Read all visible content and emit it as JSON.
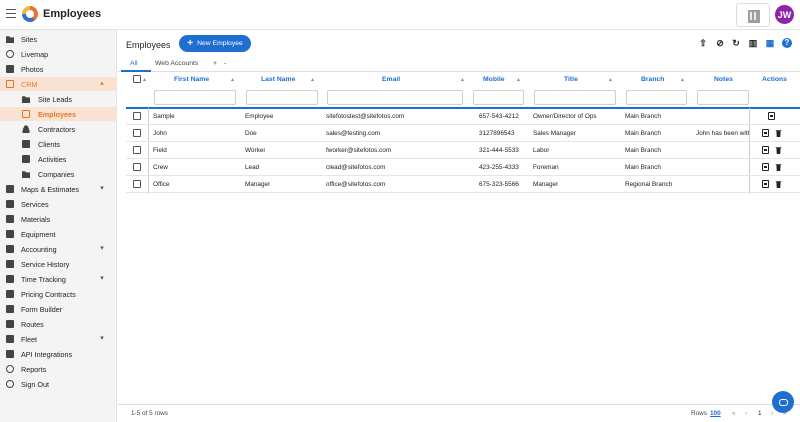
{
  "app": {
    "title": "Employees",
    "avatar_initials": "JW",
    "avatar_color": "#8e24aa",
    "accent": "#1f6fd0",
    "crm_accent": "#e8752b"
  },
  "sidebar": {
    "items": [
      {
        "label": "Sites",
        "icon": "folder-icon"
      },
      {
        "label": "Livemap",
        "icon": "globe-icon"
      },
      {
        "label": "Photos",
        "icon": "image-icon"
      },
      {
        "label": "CRM",
        "icon": "crm-icon",
        "expanded": true
      },
      {
        "label": "Site Leads",
        "icon": "folder-icon",
        "sub": true
      },
      {
        "label": "Employees",
        "icon": "employees-icon",
        "sub": true,
        "active": true
      },
      {
        "label": "Contractors",
        "icon": "person-icon",
        "sub": true
      },
      {
        "label": "Clients",
        "icon": "phone-icon",
        "sub": true
      },
      {
        "label": "Activities",
        "icon": "calendar-icon",
        "sub": true
      },
      {
        "label": "Companies",
        "icon": "folder-icon",
        "sub": true
      },
      {
        "label": "Maps & Estimates",
        "icon": "map-icon"
      },
      {
        "label": "Services",
        "icon": "wrench-icon"
      },
      {
        "label": "Materials",
        "icon": "list-icon"
      },
      {
        "label": "Equipment",
        "icon": "equipment-icon"
      },
      {
        "label": "Accounting",
        "icon": "accounting-icon"
      },
      {
        "label": "Service History",
        "icon": "history-icon"
      },
      {
        "label": "Time Tracking",
        "icon": "clock-icon"
      },
      {
        "label": "Pricing Contracts",
        "icon": "dollar-icon"
      },
      {
        "label": "Form Builder",
        "icon": "form-icon"
      },
      {
        "label": "Routes",
        "icon": "route-icon"
      },
      {
        "label": "Fleet",
        "icon": "truck-icon"
      },
      {
        "label": "API Integrations",
        "icon": "link-icon"
      },
      {
        "label": "Reports",
        "icon": "info-icon"
      },
      {
        "label": "Sign Out",
        "icon": "power-icon"
      }
    ]
  },
  "main": {
    "title": "Employees",
    "new_button": "New Employee",
    "tabs": [
      "All",
      "Web Accounts"
    ],
    "tab_add": "+",
    "tab_remove": "-",
    "columns": [
      "First Name",
      "Last Name",
      "Email",
      "Mobile",
      "Title",
      "Branch",
      "Notes",
      "Actions"
    ],
    "rows": [
      {
        "first": "Sample",
        "last": "Employee",
        "email": "sitefotostest@sitefotos.com",
        "mobile": "657-543-4212",
        "title": "Owner/Director of Ops",
        "branch": "Main Branch",
        "notes": ""
      },
      {
        "first": "John",
        "last": "Doe",
        "email": "sales@testing.com",
        "mobile": "3127896543",
        "title": "Sales Manager",
        "branch": "Main Branch",
        "notes": "John has been with"
      },
      {
        "first": "Field",
        "last": "Worker",
        "email": "fworker@sitefotos.com",
        "mobile": "321-444-5533",
        "title": "Labor",
        "branch": "Main Branch",
        "notes": ""
      },
      {
        "first": "Crew",
        "last": "Lead",
        "email": "clead@sitefotos.com",
        "mobile": "423-255-4333",
        "title": "Foreman",
        "branch": "Main Branch",
        "notes": ""
      },
      {
        "first": "Office",
        "last": "Manager",
        "email": "office@sitefotos.com",
        "mobile": "675-323-5566",
        "title": "Manager",
        "branch": "Regional Branch",
        "notes": ""
      }
    ],
    "footer": {
      "count": "1-5 of 5 rows",
      "rows_label": "Rows",
      "rows_value": "100",
      "page": "1"
    }
  }
}
